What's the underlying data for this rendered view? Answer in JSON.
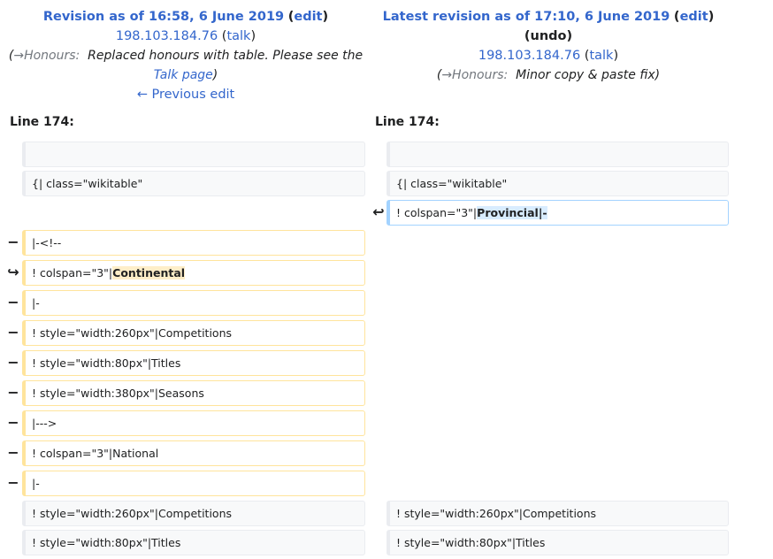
{
  "left_header": {
    "title": "Revision as of 16:58, 6 June 2019",
    "edit": "edit",
    "user": "198.103.184.76",
    "talk": "talk",
    "summary_section": "→Honours:",
    "summary_text": "Replaced honours with table.  Please see the",
    "summary_link": "Talk page",
    "prev_edit": "← Previous edit"
  },
  "right_header": {
    "title": "Latest revision as of 17:10, 6 June 2019",
    "edit": "edit",
    "undo": "undo",
    "user": "198.103.184.76",
    "talk": "talk",
    "summary_section": "→Honours:",
    "summary_text": "Minor copy & paste fix"
  },
  "line_left": "Line 174:",
  "line_right": "Line 174:",
  "markers": {
    "minus": "−",
    "moved_out": "↪",
    "moved_in": "↩"
  },
  "rows": {
    "r0": {
      "left": "",
      "right": ""
    },
    "r1": {
      "left": "{| class=\"wikitable\"",
      "right": "{| class=\"wikitable\""
    },
    "r2": {
      "right_pre": "! colspan=\"3\"|",
      "right_hl": "Provincial|-"
    },
    "r3": {
      "left": "|-<!--"
    },
    "r4": {
      "left_pre": "! colspan=\"3\"|",
      "left_hl": "Continental"
    },
    "r5": {
      "left": "|-"
    },
    "r6": {
      "left": "! style=\"width:260px\"|Competitions"
    },
    "r7": {
      "left": "! style=\"width:80px\"|Titles"
    },
    "r8": {
      "left": "! style=\"width:380px\"|Seasons"
    },
    "r9": {
      "left": "|--->"
    },
    "r10": {
      "left": "! colspan=\"3\"|National"
    },
    "r11": {
      "left": "|-"
    },
    "r12": {
      "left": "! style=\"width:260px\"|Competitions",
      "right": "! style=\"width:260px\"|Competitions"
    },
    "r13": {
      "left": "! style=\"width:80px\"|Titles",
      "right": "! style=\"width:80px\"|Titles"
    }
  }
}
